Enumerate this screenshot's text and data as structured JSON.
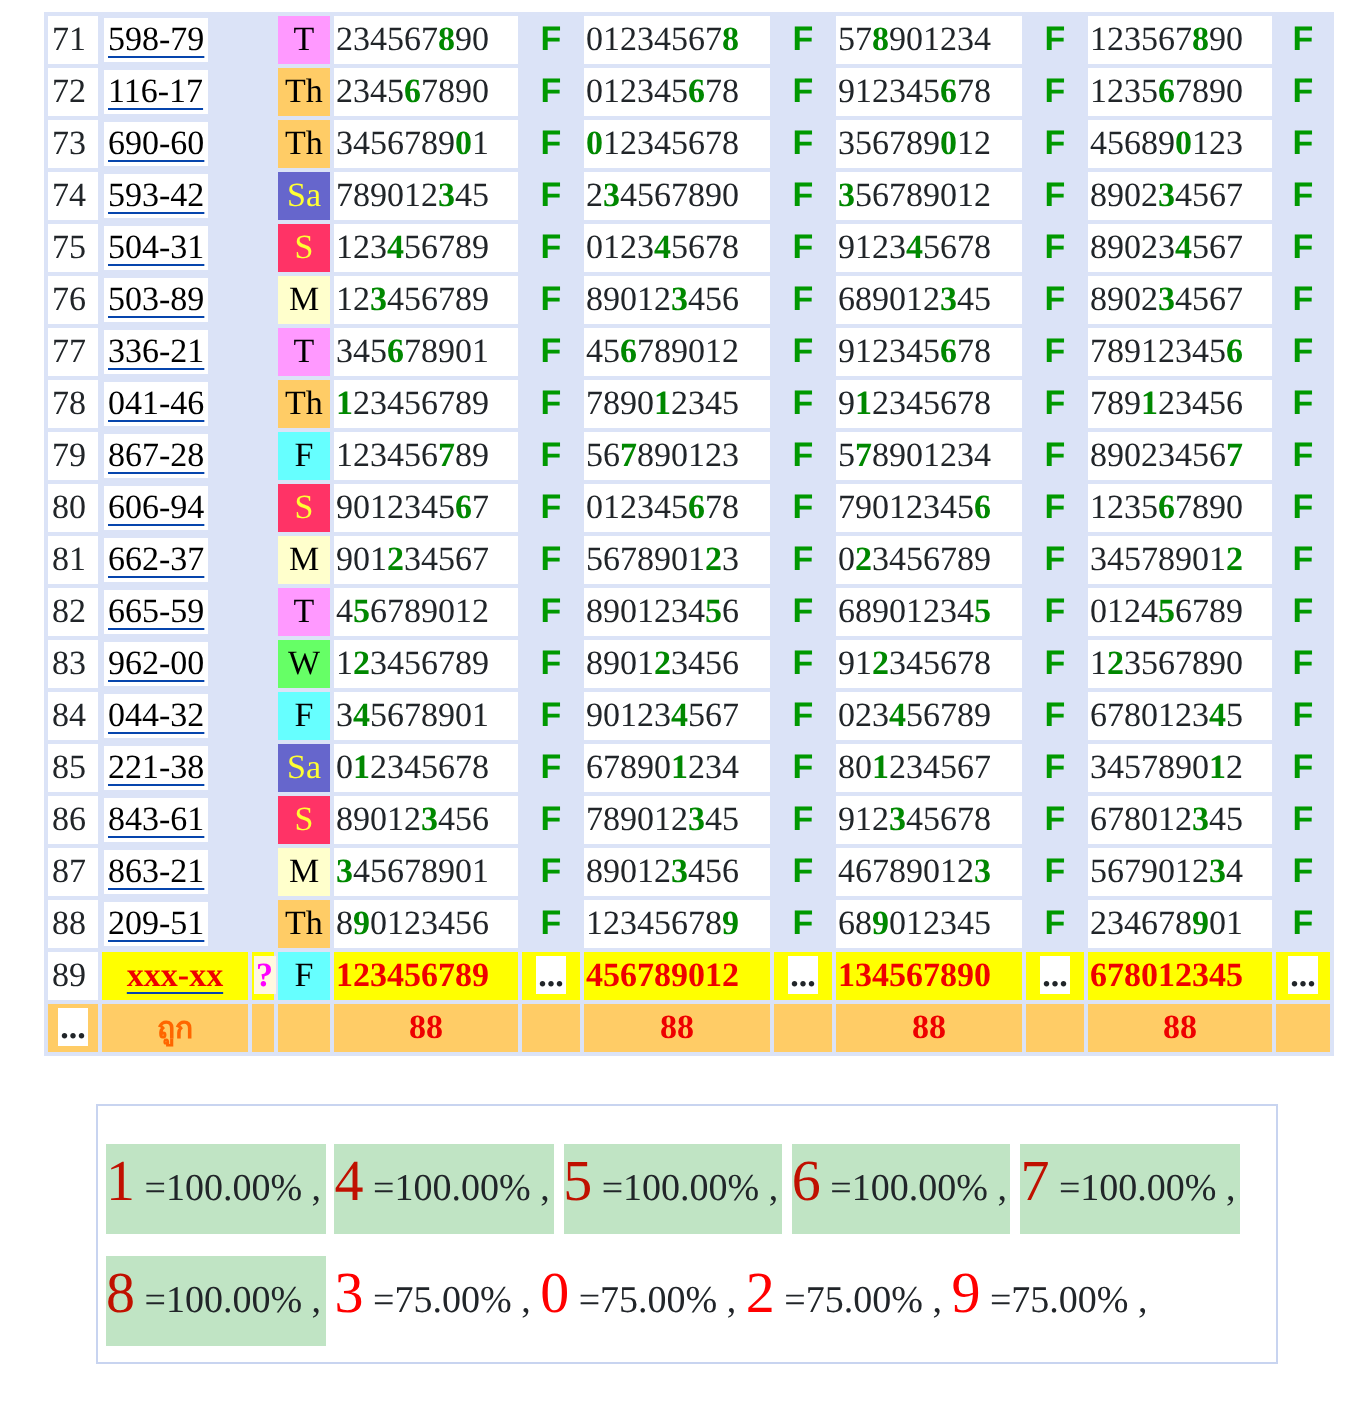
{
  "rows": [
    {
      "no": "71",
      "code": "598-79",
      "day": {
        "label": "T",
        "color": "#ff99ff"
      },
      "cells": [
        {
          "pre": "234567",
          "hit": "8",
          "post": "90",
          "result": "F"
        },
        {
          "pre": "01234567",
          "hit": "8",
          "result": "F"
        },
        {
          "pre": "57",
          "hit": "8",
          "post": "901234",
          "result": "F"
        },
        {
          "pre": "123567",
          "hit": "8",
          "post": "90",
          "result": "F"
        }
      ]
    },
    {
      "no": "72",
      "code": "116-17",
      "day": {
        "label": "Th",
        "color": "#ffcc66"
      },
      "cells": [
        {
          "pre": "2345",
          "hit": "6",
          "post": "7890",
          "result": "F"
        },
        {
          "pre": "012345",
          "hit": "6",
          "post": "78",
          "result": "F"
        },
        {
          "pre": "912345",
          "hit": "6",
          "post": "78",
          "result": "F"
        },
        {
          "pre": "1235",
          "hit": "6",
          "post": "7890",
          "result": "F"
        }
      ]
    },
    {
      "no": "73",
      "code": "690-60",
      "day": {
        "label": "Th",
        "color": "#ffcc66"
      },
      "cells": [
        {
          "pre": "3456789",
          "hit": "0",
          "post": "1",
          "result": "F"
        },
        {
          "hit": "0",
          "post": "12345678",
          "result": "F"
        },
        {
          "pre": "356789",
          "hit": "0",
          "post": "12",
          "result": "F"
        },
        {
          "pre": "45689",
          "hit": "0",
          "post": "123",
          "result": "F"
        }
      ]
    },
    {
      "no": "74",
      "code": "593-42",
      "day": {
        "label": "Sa",
        "color": "#6666cc"
      },
      "cells": [
        {
          "pre": "789012",
          "hit": "3",
          "post": "45",
          "result": "F"
        },
        {
          "pre": "2",
          "hit": "3",
          "post": "4567890",
          "result": "F"
        },
        {
          "hit": "3",
          "post": "56789012",
          "result": "F"
        },
        {
          "pre": "8902",
          "hit": "3",
          "post": "4567",
          "result": "F"
        }
      ]
    },
    {
      "no": "75",
      "code": "504-31",
      "day": {
        "label": "S",
        "color": "#ff3366"
      },
      "cells": [
        {
          "pre": "123",
          "hit": "4",
          "post": "56789",
          "result": "F"
        },
        {
          "pre": "0123",
          "hit": "4",
          "post": "5678",
          "result": "F"
        },
        {
          "pre": "9123",
          "hit": "4",
          "post": "5678",
          "result": "F"
        },
        {
          "pre": "89023",
          "hit": "4",
          "post": "567",
          "result": "F"
        }
      ]
    },
    {
      "no": "76",
      "code": "503-89",
      "day": {
        "label": "M",
        "color": "#ffffcc"
      },
      "cells": [
        {
          "pre": "12",
          "hit": "3",
          "post": "456789",
          "result": "F"
        },
        {
          "pre": "89012",
          "hit": "3",
          "post": "456",
          "result": "F"
        },
        {
          "pre": "689012",
          "hit": "3",
          "post": "45",
          "result": "F"
        },
        {
          "pre": "8902",
          "hit": "3",
          "post": "4567",
          "result": "F"
        }
      ]
    },
    {
      "no": "77",
      "code": "336-21",
      "day": {
        "label": "T",
        "color": "#ff99ff"
      },
      "cells": [
        {
          "pre": "345",
          "hit": "6",
          "post": "78901",
          "result": "F"
        },
        {
          "pre": "45",
          "hit": "6",
          "post": "789012",
          "result": "F"
        },
        {
          "pre": "912345",
          "hit": "6",
          "post": "78",
          "result": "F"
        },
        {
          "pre": "78912345",
          "hit": "6",
          "result": "F"
        }
      ]
    },
    {
      "no": "78",
      "code": "041-46",
      "day": {
        "label": "Th",
        "color": "#ffcc66"
      },
      "cells": [
        {
          "hit": "1",
          "post": "23456789",
          "result": "F"
        },
        {
          "pre": "7890",
          "hit": "1",
          "post": "2345",
          "result": "F"
        },
        {
          "pre": "9",
          "hit": "1",
          "post": "2345678",
          "result": "F"
        },
        {
          "pre": "789",
          "hit": "1",
          "post": "23456",
          "result": "F"
        }
      ]
    },
    {
      "no": "79",
      "code": "867-28",
      "day": {
        "label": "F",
        "color": "#66ffff"
      },
      "cells": [
        {
          "pre": "123456",
          "hit": "7",
          "post": "89",
          "result": "F"
        },
        {
          "pre": "56",
          "hit": "7",
          "post": "890123",
          "result": "F"
        },
        {
          "pre": "5",
          "hit": "7",
          "post": "8901234",
          "result": "F"
        },
        {
          "pre": "89023456",
          "hit": "7",
          "result": "F"
        }
      ]
    },
    {
      "no": "80",
      "code": "606-94",
      "day": {
        "label": "S",
        "color": "#ff3366"
      },
      "cells": [
        {
          "pre": "9012345",
          "hit": "6",
          "post": "7",
          "result": "F"
        },
        {
          "pre": "012345",
          "hit": "6",
          "post": "78",
          "result": "F"
        },
        {
          "pre": "79012345",
          "hit": "6",
          "result": "F"
        },
        {
          "pre": "1235",
          "hit": "6",
          "post": "7890",
          "result": "F"
        }
      ]
    },
    {
      "no": "81",
      "code": "662-37",
      "day": {
        "label": "M",
        "color": "#ffffcc"
      },
      "cells": [
        {
          "pre": "901",
          "hit": "2",
          "post": "34567",
          "result": "F"
        },
        {
          "pre": "5678901",
          "hit": "2",
          "post": "3",
          "result": "F"
        },
        {
          "pre": "0",
          "hit": "2",
          "post": "3456789",
          "result": "F"
        },
        {
          "pre": "34578901",
          "hit": "2",
          "result": "F"
        }
      ]
    },
    {
      "no": "82",
      "code": "665-59",
      "day": {
        "label": "T",
        "color": "#ff99ff"
      },
      "cells": [
        {
          "pre": "4",
          "hit": "5",
          "post": "6789012",
          "result": "F"
        },
        {
          "pre": "8901234",
          "hit": "5",
          "post": "6",
          "result": "F"
        },
        {
          "pre": "68901234",
          "hit": "5",
          "result": "F"
        },
        {
          "pre": "0124",
          "hit": "5",
          "post": "6789",
          "result": "F"
        }
      ]
    },
    {
      "no": "83",
      "code": "962-00",
      "day": {
        "label": "W",
        "color": "#66ff66"
      },
      "cells": [
        {
          "pre": "1",
          "hit": "2",
          "post": "3456789",
          "result": "F"
        },
        {
          "pre": "8901",
          "hit": "2",
          "post": "3456",
          "result": "F"
        },
        {
          "pre": "91",
          "hit": "2",
          "post": "345678",
          "result": "F"
        },
        {
          "pre": "1",
          "hit": "2",
          "post": "3567890",
          "result": "F"
        }
      ]
    },
    {
      "no": "84",
      "code": "044-32",
      "day": {
        "label": "F",
        "color": "#66ffff"
      },
      "cells": [
        {
          "pre": "3",
          "hit": "4",
          "post": "5678901",
          "result": "F"
        },
        {
          "pre": "90123",
          "hit": "4",
          "post": "567",
          "result": "F"
        },
        {
          "pre": "023",
          "hit": "4",
          "post": "56789",
          "result": "F"
        },
        {
          "pre": "6780123",
          "hit": "4",
          "post": "5",
          "result": "F"
        }
      ]
    },
    {
      "no": "85",
      "code": "221-38",
      "day": {
        "label": "Sa",
        "color": "#6666cc"
      },
      "cells": [
        {
          "pre": "0",
          "hit": "1",
          "post": "2345678",
          "result": "F"
        },
        {
          "pre": "67890",
          "hit": "1",
          "post": "234",
          "result": "F"
        },
        {
          "pre": "80",
          "hit": "1",
          "post": "234567",
          "result": "F"
        },
        {
          "pre": "3457890",
          "hit": "1",
          "post": "2",
          "result": "F"
        }
      ]
    },
    {
      "no": "86",
      "code": "843-61",
      "day": {
        "label": "S",
        "color": "#ff3366"
      },
      "cells": [
        {
          "pre": "89012",
          "hit": "3",
          "post": "456",
          "result": "F"
        },
        {
          "pre": "789012",
          "hit": "3",
          "post": "45",
          "result": "F"
        },
        {
          "pre": "912",
          "hit": "3",
          "post": "45678",
          "result": "F"
        },
        {
          "pre": "678012",
          "hit": "3",
          "post": "45",
          "result": "F"
        }
      ]
    },
    {
      "no": "87",
      "code": "863-21",
      "day": {
        "label": "M",
        "color": "#ffffcc"
      },
      "cells": [
        {
          "hit": "3",
          "post": "45678901",
          "result": "F"
        },
        {
          "pre": "89012",
          "hit": "3",
          "post": "456",
          "result": "F"
        },
        {
          "pre": "46789012",
          "hit": "3",
          "result": "F"
        },
        {
          "pre": "5679012",
          "hit": "3",
          "post": "4",
          "result": "F"
        }
      ]
    },
    {
      "no": "88",
      "code": "209-51",
      "day": {
        "label": "Th",
        "color": "#ffcc66"
      },
      "cells": [
        {
          "pre": "8",
          "hit": "9",
          "post": "0123456",
          "result": "F"
        },
        {
          "pre": "12345678",
          "hit": "9",
          "result": "F"
        },
        {
          "pre": "68",
          "hit": "9",
          "post": "012345",
          "result": "F"
        },
        {
          "pre": "234678",
          "hit": "9",
          "post": "01",
          "result": "F"
        }
      ]
    }
  ],
  "pending": {
    "no": "89",
    "code": "xxx-xx",
    "mark": "?",
    "day": {
      "label": "F",
      "color": "#66ffff"
    },
    "cells": [
      {
        "number": "123456789",
        "result": "..."
      },
      {
        "number": "456789012",
        "result": "..."
      },
      {
        "number": "134567890",
        "result": "..."
      },
      {
        "number": "678012345",
        "result": "..."
      }
    ]
  },
  "footer": {
    "more": "...",
    "label": "ถูก",
    "counts": [
      "88",
      "88",
      "88",
      "88"
    ]
  },
  "legend": [
    {
      "digit": "1",
      "value": "=100.00%",
      "separator": ",",
      "highlighted": true
    },
    {
      "digit": "4",
      "value": "=100.00%",
      "separator": ",",
      "highlighted": true
    },
    {
      "digit": "5",
      "value": "=100.00%",
      "separator": ",",
      "highlighted": true
    },
    {
      "digit": "6",
      "value": "=100.00%",
      "separator": ",",
      "highlighted": true
    },
    {
      "digit": "7",
      "value": "=100.00%",
      "separator": ",",
      "highlighted": true
    },
    {
      "digit": "8",
      "value": "=100.00%",
      "separator": ",",
      "highlighted": true
    },
    {
      "digit": "3",
      "value": "=75.00%",
      "separator": ",",
      "highlighted": false
    },
    {
      "digit": "0",
      "value": "=75.00%",
      "separator": ",",
      "highlighted": false
    },
    {
      "digit": "2",
      "value": "=75.00%",
      "separator": ",",
      "highlighted": false
    },
    {
      "digit": "9",
      "value": "=75.00%",
      "separator": ",",
      "highlighted": false
    }
  ]
}
